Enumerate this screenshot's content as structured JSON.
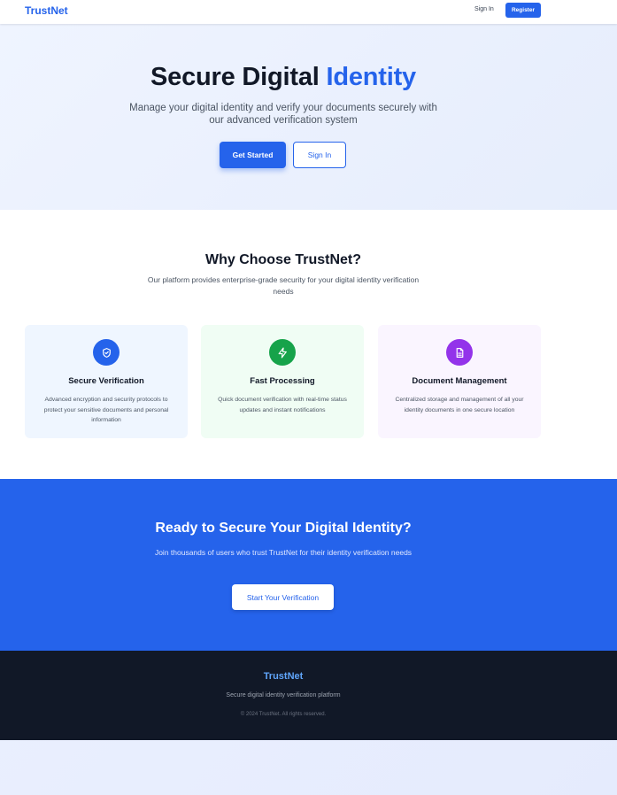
{
  "nav": {
    "brand": "TrustNet",
    "signin": "Sign In",
    "register": "Register"
  },
  "hero": {
    "title_main": "Secure Digital",
    "title_accent": "Identity",
    "subtitle": "Manage your digital identity and verify your documents securely with our advanced verification system",
    "primary_button": "Get Started",
    "secondary_button": "Sign In"
  },
  "features": {
    "heading": "Why Choose TrustNet?",
    "subheading": "Our platform provides enterprise-grade security for your digital identity verification needs",
    "cards": [
      {
        "icon": "shield-check-icon",
        "title": "Secure Verification",
        "description": "Advanced encryption and security protocols to protect your sensitive documents and personal information"
      },
      {
        "icon": "lightning-icon",
        "title": "Fast Processing",
        "description": "Quick document verification with real-time status updates and instant notifications"
      },
      {
        "icon": "document-icon",
        "title": "Document Management",
        "description": "Centralized storage and management of all your identity documents in one secure location"
      }
    ]
  },
  "cta": {
    "heading": "Ready to Secure Your Digital Identity?",
    "subheading": "Join thousands of users who trust TrustNet for their identity verification needs",
    "button": "Start Your Verification"
  },
  "footer": {
    "brand": "TrustNet",
    "tagline": "Secure digital identity verification platform",
    "copyright": "© 2024 TrustNet. All rights reserved."
  },
  "colors": {
    "primary": "#2563eb",
    "green": "#16a34a",
    "purple": "#9333ea",
    "footer_bg": "#111827"
  }
}
